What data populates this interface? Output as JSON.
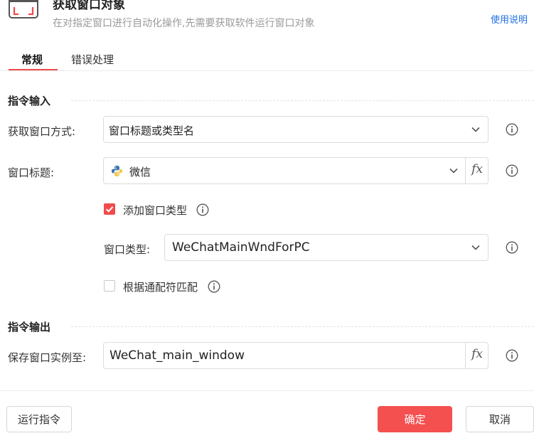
{
  "header": {
    "title": "获取窗口对象",
    "subtitle": "在对指定窗口进行自动化操作,先需要获取软件运行窗口对象",
    "help_link": "使用说明"
  },
  "tabs": [
    {
      "label": "常规",
      "active": true
    },
    {
      "label": "错误处理",
      "active": false
    }
  ],
  "input_section": {
    "title": "指令输入",
    "window_method": {
      "label": "获取窗口方式:",
      "value": "窗口标题或类型名"
    },
    "window_title": {
      "label": "窗口标题:",
      "value": "微信",
      "fx": "fx"
    },
    "add_window_type": {
      "label": "添加窗口类型",
      "checked": true
    },
    "window_type": {
      "label": "窗口类型:",
      "value": "WeChatMainWndForPC"
    },
    "wildcard_match": {
      "label": "根据通配符匹配",
      "checked": false
    }
  },
  "output_section": {
    "title": "指令输出",
    "save_instance": {
      "label": "保存窗口实例至:",
      "value": "WeChat_main_window",
      "fx": "fx"
    }
  },
  "footer": {
    "run_label": "运行指令",
    "ok_label": "确定",
    "cancel_label": "取消"
  },
  "colors": {
    "accent": "#f04b4b",
    "link": "#1f6fe5",
    "python_blue": "#3a72b0",
    "python_yellow": "#f2c94c"
  }
}
